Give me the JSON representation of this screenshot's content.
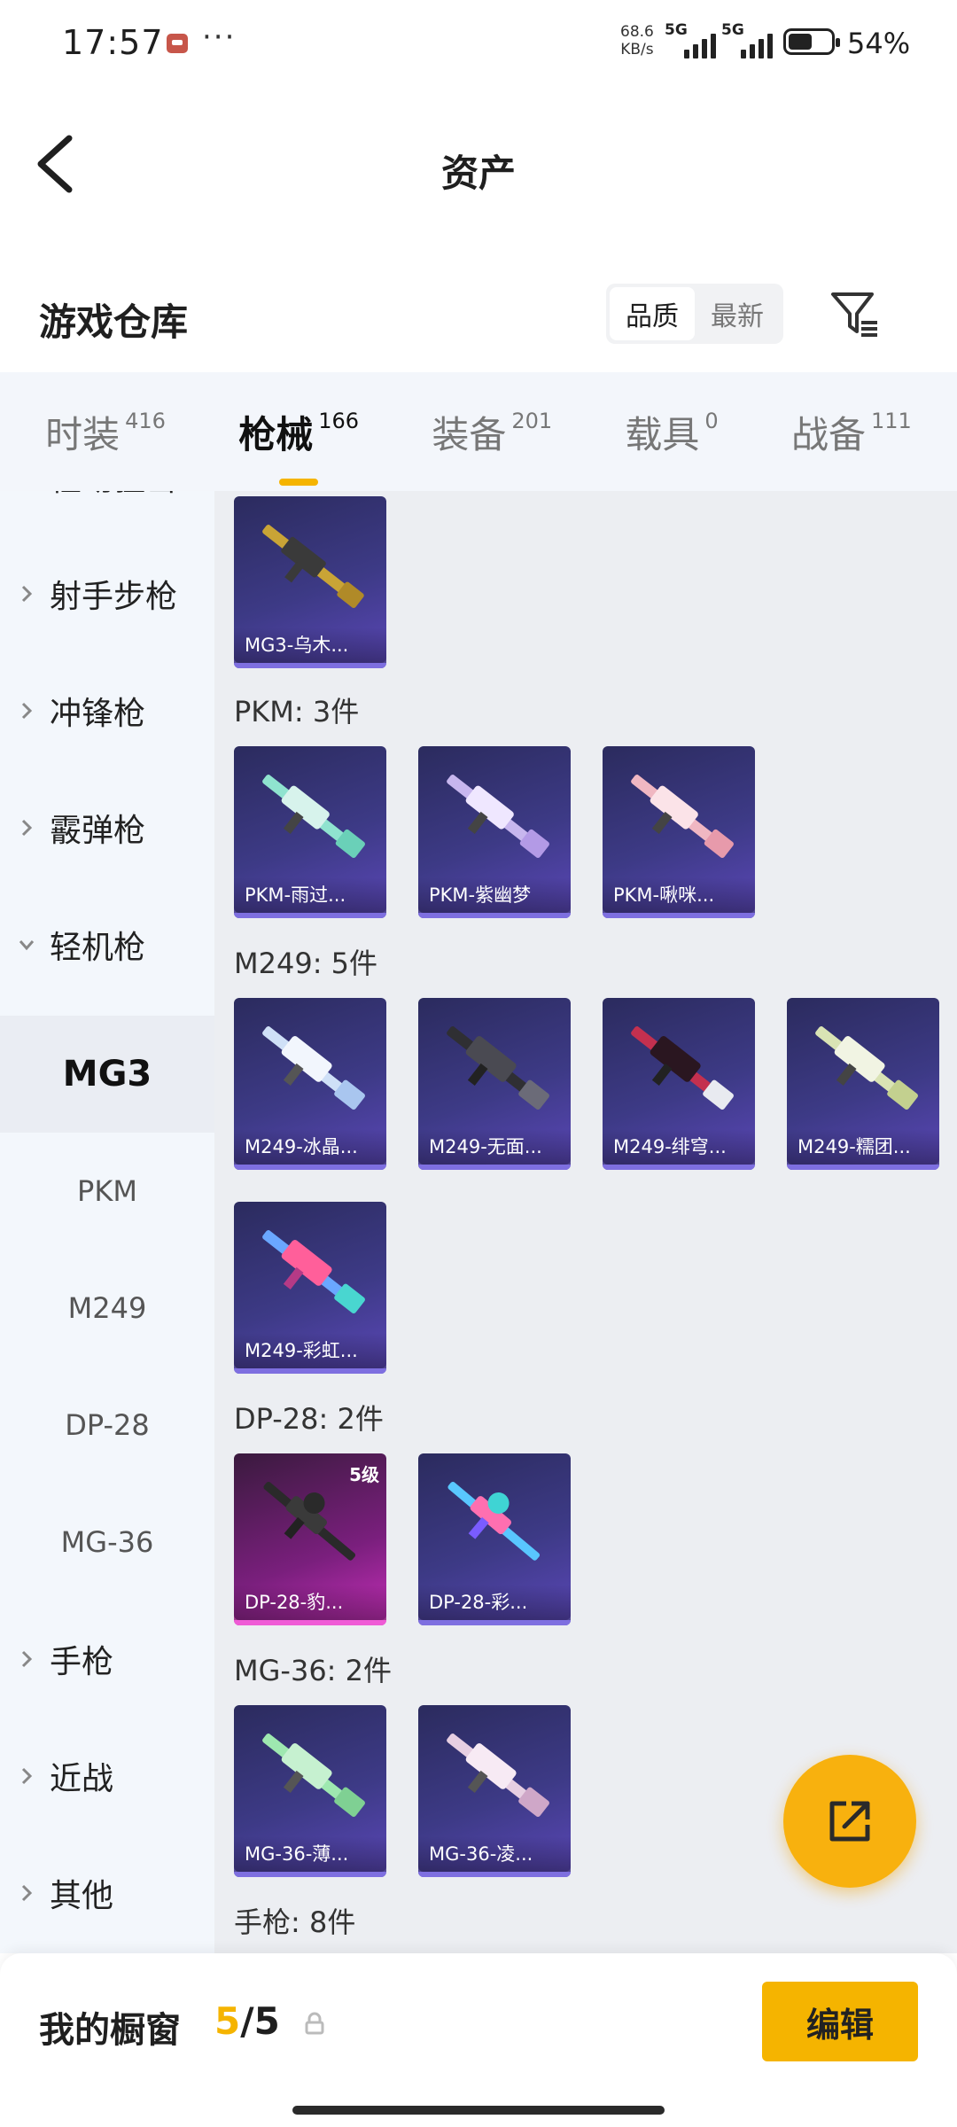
{
  "status_bar": {
    "time": "17:57",
    "speed_value": "68.6",
    "speed_unit": "KB/s",
    "sim1_tag": "5G",
    "sim2_tag": "5G",
    "battery": "54%"
  },
  "header": {
    "title": "资产",
    "warehouse_title": "游戏仓库",
    "sort_options": [
      "品质",
      "最新"
    ],
    "sort_selected": "品质"
  },
  "categories": [
    {
      "label": "时装",
      "count": "416"
    },
    {
      "label": "枪械",
      "count": "166",
      "active": true
    },
    {
      "label": "装备",
      "count": "201"
    },
    {
      "label": "载具",
      "count": "0"
    },
    {
      "label": "战备",
      "count": "111"
    }
  ],
  "side_menu": {
    "partial_top": "栓动狙击",
    "items": [
      "射手步枪",
      "冲锋枪",
      "霰弹枪",
      "轻机枪"
    ],
    "sub_items": [
      "MG3",
      "PKM",
      "M249",
      "DP-28",
      "MG-36"
    ],
    "sub_active": "MG3",
    "more_items": [
      "手枪",
      "近战",
      "其他"
    ]
  },
  "groups": [
    {
      "title": "",
      "items": [
        {
          "name": "MG3-乌木...",
          "rarity": "purple"
        }
      ]
    },
    {
      "title": "PKM: 3件",
      "items": [
        {
          "name": "PKM-雨过...",
          "rarity": "purple"
        },
        {
          "name": "PKM-紫幽梦",
          "rarity": "purple"
        },
        {
          "name": "PKM-啾咪...",
          "rarity": "purple"
        }
      ]
    },
    {
      "title": "M249: 5件",
      "items": [
        {
          "name": "M249-冰晶...",
          "rarity": "purple"
        },
        {
          "name": "M249-无面...",
          "rarity": "purple"
        },
        {
          "name": "M249-绯穹...",
          "rarity": "purple"
        },
        {
          "name": "M249-糯团...",
          "rarity": "purple"
        },
        {
          "name": "M249-彩虹...",
          "rarity": "purple"
        }
      ]
    },
    {
      "title": "DP-28: 2件",
      "items": [
        {
          "name": "DP-28-豹...",
          "rarity": "pink",
          "level": "5级"
        },
        {
          "name": "DP-28-彩...",
          "rarity": "purple"
        }
      ]
    },
    {
      "title": "MG-36: 2件",
      "items": [
        {
          "name": "MG-36-薄...",
          "rarity": "purple"
        },
        {
          "name": "MG-36-凌...",
          "rarity": "purple"
        }
      ]
    },
    {
      "title": "手枪: 8件",
      "items": []
    }
  ],
  "colors": {
    "accent": "#f5b400",
    "card_purple": "#3d3a86",
    "card_pink": "#c62fb9"
  },
  "bottom": {
    "window_label": "我的橱窗",
    "window_current": "5",
    "window_sep": "/",
    "window_total": "5",
    "edit_label": "编辑"
  }
}
